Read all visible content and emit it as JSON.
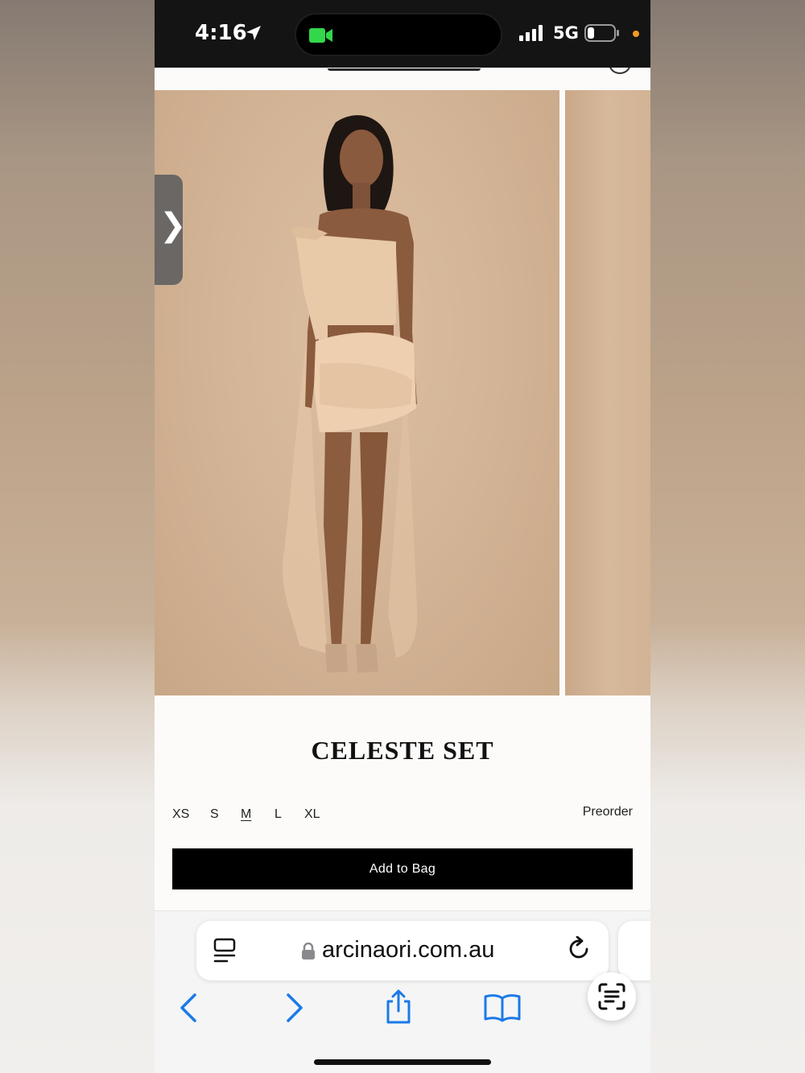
{
  "status_bar": {
    "time": "4:16",
    "network": "5G"
  },
  "product": {
    "title": "CELESTE SET",
    "sizes": [
      {
        "label": "XS",
        "selected": false
      },
      {
        "label": "S",
        "selected": false
      },
      {
        "label": "M",
        "selected": true
      },
      {
        "label": "L",
        "selected": false
      },
      {
        "label": "XL",
        "selected": false
      }
    ],
    "availability": "Preorder",
    "add_to_bag_label": "Add to Bag"
  },
  "browser": {
    "url": "arcinaori.com.au"
  },
  "colors": {
    "accent_blue": "#1a7ae8",
    "button_black": "#000000",
    "image_beige": "#d4b597"
  }
}
